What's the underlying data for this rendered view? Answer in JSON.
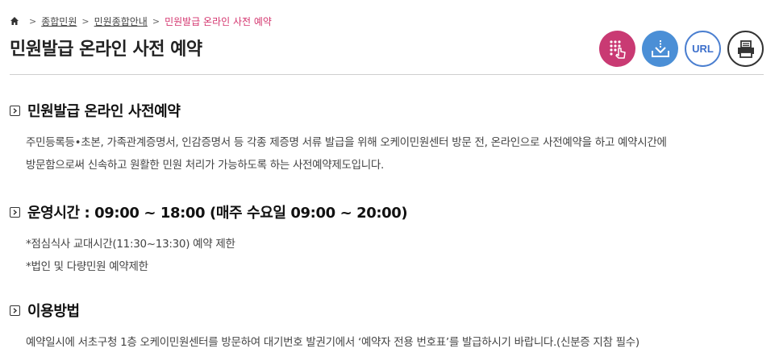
{
  "breadcrumb": {
    "items": [
      "종합민원",
      "민원종합안내"
    ],
    "current": "민원발급 온라인 사전 예약",
    "separator": ">"
  },
  "page": {
    "title": "민원발급 온라인 사전 예약"
  },
  "tools": {
    "url_label": "URL",
    "icons": [
      "keypad-touch-icon",
      "download-icon",
      "url-icon",
      "print-icon"
    ]
  },
  "sections": [
    {
      "title": "민원발급 온라인 사전예약",
      "lines": [
        "주민등록등•초본, 가족관계증명서, 인감증명서 등 각종 제증명 서류 발급을 위해 오케이민원센터 방문 전, 온라인으로 사전예약을 하고 예약시간에",
        "방문함으로써 신속하고 원활한 민원 처리가 가능하도록 하는 사전예약제도입니다."
      ]
    },
    {
      "title": "운영시간 : 09:00 ~ 18:00 (매주 수요일 09:00 ~ 20:00)",
      "lines": [
        "*점심식사 교대시간(11:30~13:30) 예약 제한",
        "*법인 및 다량민원 예약제한"
      ]
    },
    {
      "title": "이용방법",
      "lines": [
        "예약일시에 서초구청 1층 오케이민원센터를 방문하여 대기번호 발권기에서 ‘예약자 전용 번호표’를 발급하시기 바랍니다.(신분증 지참 필수)"
      ]
    }
  ],
  "colors": {
    "accent_pink": "#c93a73",
    "accent_blue": "#4b8fd6",
    "breadcrumb_current": "#d4366f"
  }
}
